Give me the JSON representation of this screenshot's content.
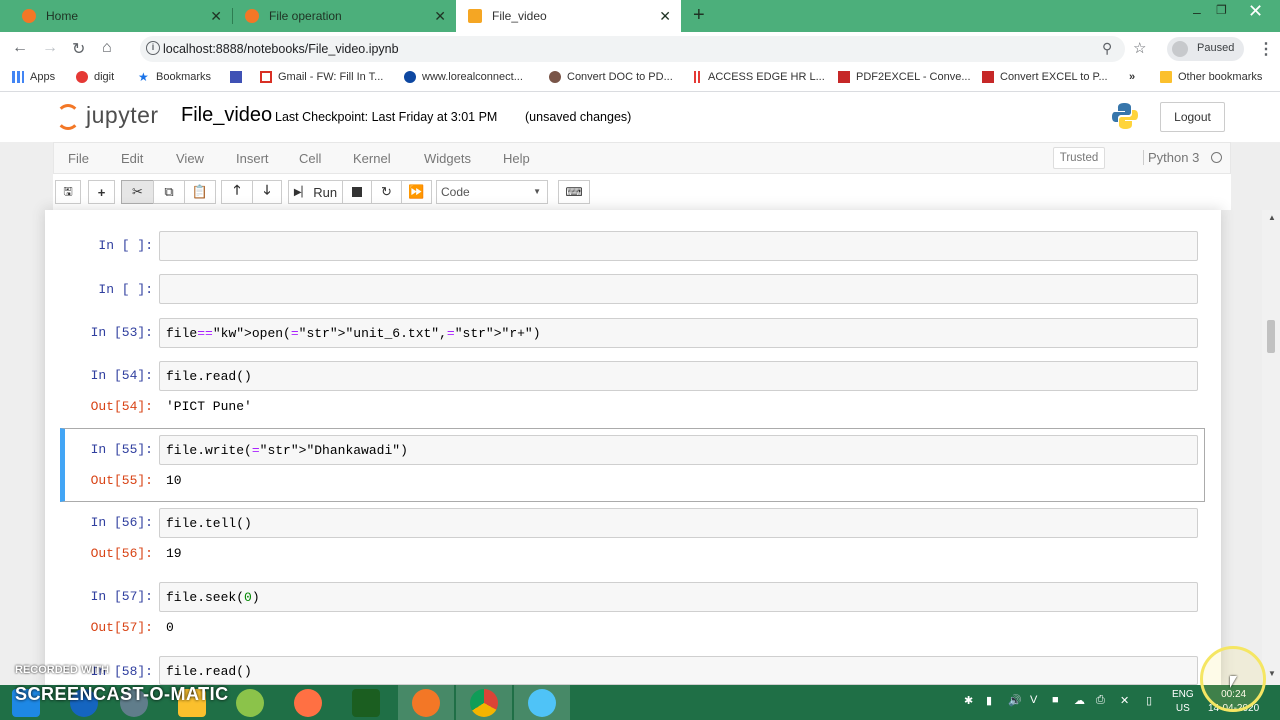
{
  "browser": {
    "tabs": [
      {
        "label": "Home",
        "color": "#f37726"
      },
      {
        "label": "File operation",
        "color": "#f37726"
      },
      {
        "label": "File_video",
        "color": "#f37726"
      }
    ],
    "url": "localhost:8888/notebooks/File_video.ipynb",
    "profile_status": "Paused",
    "bookmarks": [
      {
        "label": "Apps"
      },
      {
        "label": "digit"
      },
      {
        "label": "Bookmarks"
      },
      {
        "label": ""
      },
      {
        "label": "Gmail - FW: Fill In T..."
      },
      {
        "label": "www.lorealconnect..."
      },
      {
        "label": "Convert DOC to PD..."
      },
      {
        "label": "ACCESS EDGE HR L..."
      },
      {
        "label": "PDF2EXCEL - Conve..."
      },
      {
        "label": "Convert EXCEL to P..."
      }
    ],
    "more_bookmarks": "»",
    "other_bookmarks": "Other bookmarks"
  },
  "jupyter": {
    "logo_text": "jupyter",
    "notebook_name": "File_video",
    "checkpoint": "Last Checkpoint: Last Friday at 3:01 PM",
    "unsaved": "(unsaved changes)",
    "logout": "Logout",
    "menu": [
      "File",
      "Edit",
      "View",
      "Insert",
      "Cell",
      "Kernel",
      "Widgets",
      "Help"
    ],
    "trusted": "Trusted",
    "kernel": "Python 3",
    "toolbar": {
      "run_label": "Run",
      "cell_type": "Code"
    }
  },
  "cells": [
    {
      "prompt": "In [ ]:",
      "code": ""
    },
    {
      "prompt": "In [ ]:",
      "code": ""
    },
    {
      "prompt": "In [53]:",
      "code": "file=open(\"unit_6.txt\",\"r+\")"
    },
    {
      "prompt": "In [54]:",
      "code": "file.read()",
      "out_prompt": "Out[54]:",
      "output": "'PICT Pune'"
    },
    {
      "prompt": "In [55]:",
      "code": "file.write(\"Dhankawadi\")",
      "out_prompt": "Out[55]:",
      "output": "10"
    },
    {
      "prompt": "In [56]:",
      "code": "file.tell()",
      "out_prompt": "Out[56]:",
      "output": "19"
    },
    {
      "prompt": "In [57]:",
      "code": "file.seek(0)",
      "out_prompt": "Out[57]:",
      "output": "0"
    },
    {
      "prompt": "In [58]:",
      "code": "file.read()"
    }
  ],
  "taskbar": {
    "recorded_with": "RECORDED WITH",
    "screencast": "SCREENCAST-O-MATIC",
    "lang": "ENG",
    "lang_region": "US",
    "time": "00:24",
    "date": "14-04-2020"
  }
}
